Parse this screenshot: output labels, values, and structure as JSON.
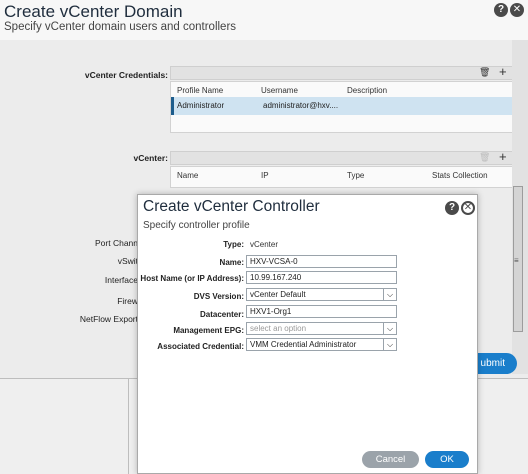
{
  "outer": {
    "title": "Create vCenter Domain",
    "subtitle": "Specify vCenter domain users and controllers",
    "credentials_label": "vCenter Credentials:",
    "credentials_columns": [
      "Profile Name",
      "Username",
      "Description"
    ],
    "credentials_rows": [
      {
        "profile_name": "Administrator",
        "username": "administrator@hxv....",
        "description": ""
      }
    ],
    "vcenter_label": "vCenter:",
    "vcenter_columns": [
      "Name",
      "IP",
      "Type",
      "Stats Collection"
    ],
    "left_labels": [
      "Port Chann",
      "vSwit",
      "Interface",
      "Firew",
      "NetFlow Export"
    ],
    "submit_label": "ubmit",
    "help_icon": "?",
    "close_icon": "✕",
    "trash_icon": "🗑",
    "plus_icon": "+"
  },
  "inner": {
    "title": "Create vCenter Controller",
    "subtitle": "Specify controller profile",
    "fields": {
      "type_label": "Type:",
      "type_value": "vCenter",
      "name_label": "Name:",
      "name_value": "HXV-VCSA-0",
      "host_label": "Host Name (or IP Address):",
      "host_value": "10.99.167.240",
      "dvs_label": "DVS Version:",
      "dvs_value": "vCenter Default",
      "datacenter_label": "Datacenter:",
      "datacenter_value": "HXV1-Org1",
      "epg_label": "Management EPG:",
      "epg_placeholder": "select an option",
      "cred_label": "Associated Credential:",
      "cred_value": "VMM Credential Administrator"
    },
    "cancel_label": "Cancel",
    "ok_label": "OK"
  },
  "colors": {
    "accent": "#1a7ecb",
    "selected_row": "#cfe3f1",
    "dialog_border": "#a9a9a9"
  }
}
